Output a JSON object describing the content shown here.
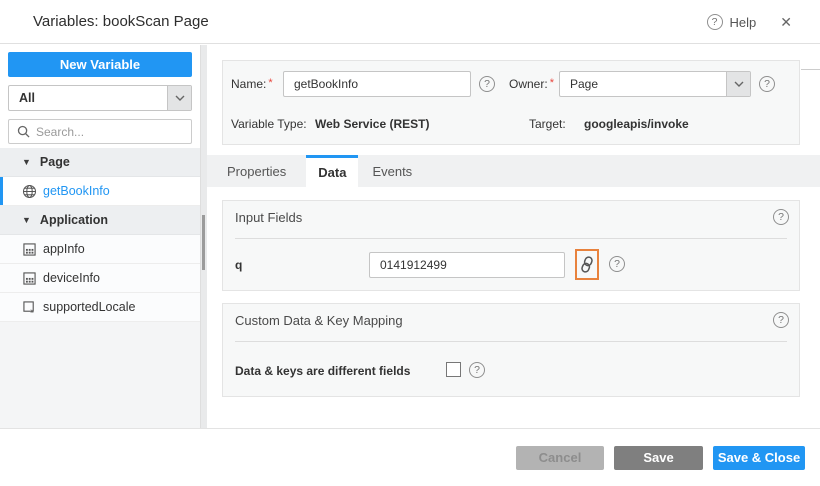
{
  "header": {
    "title": "Variables: bookScan Page",
    "help_label": "Help",
    "help_glyph": "?",
    "close_glyph": "✕"
  },
  "sidebar": {
    "new_variable_button": "New Variable",
    "filter": {
      "selected": "All"
    },
    "search_placeholder": "Search...",
    "tree": [
      {
        "label": "Page",
        "type": "group"
      },
      {
        "label": "getBookInfo",
        "type": "item",
        "icon": "globe-icon",
        "selected": true
      },
      {
        "label": "Application",
        "type": "group"
      },
      {
        "label": "appInfo",
        "type": "item",
        "icon": "data-grid-icon",
        "selected": false
      },
      {
        "label": "deviceInfo",
        "type": "item",
        "icon": "data-grid-icon",
        "selected": false
      },
      {
        "label": "supportedLocale",
        "type": "item",
        "icon": "locale-variable-icon",
        "selected": false
      }
    ]
  },
  "details": {
    "name_label": "Name:",
    "name_required": "*",
    "name_value": "getBookInfo",
    "owner_label": "Owner:",
    "owner_required": "*",
    "owner_value": "Page",
    "variable_type_label": "Variable Type:",
    "variable_type_value": "Web Service (REST)",
    "target_label": "Target:",
    "target_value": "googleapis/invoke"
  },
  "tabs": [
    {
      "label": "Properties",
      "active": false
    },
    {
      "label": "Data",
      "active": true
    },
    {
      "label": "Events",
      "active": false
    }
  ],
  "input_fields": {
    "title": "Input Fields",
    "rows": [
      {
        "key": "q",
        "value": "0141912499"
      }
    ]
  },
  "custom_mapping": {
    "title": "Custom Data & Key Mapping",
    "checkbox_label": "Data & keys are different fields",
    "checked": false
  },
  "footer": {
    "cancel_label": "Cancel",
    "save_label": "Save",
    "save_close_label": "Save & Close"
  },
  "colors": {
    "accent_blue": "#2196f3",
    "highlight_orange": "#e8823d",
    "required_red": "#e8453c"
  }
}
